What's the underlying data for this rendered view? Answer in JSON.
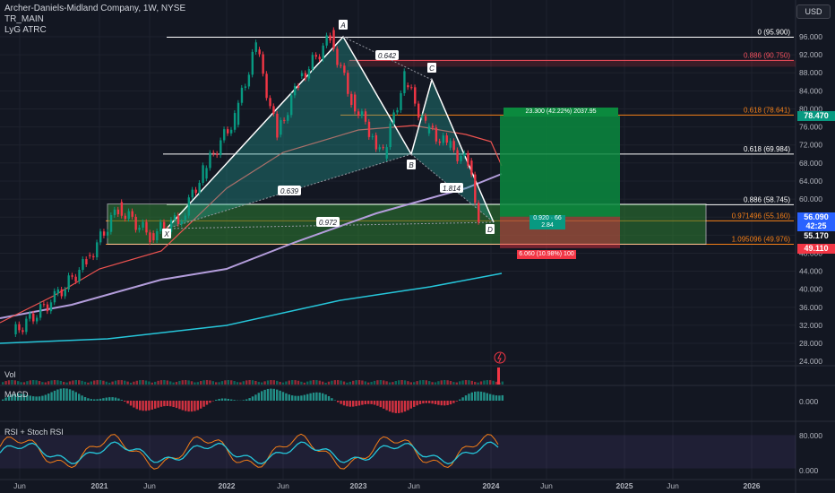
{
  "legend": {
    "title": "Archer-Daniels-Midland Company, 1W, NYSE",
    "ind1": "TR_MAIN",
    "ind2": "LyG ATRC"
  },
  "currency": "USD",
  "panes": {
    "vol": "Vol",
    "macd": "MACD",
    "rsi": "RSI + Stoch RSI"
  },
  "pattern_points": [
    {
      "label": "X",
      "date": "2021-06",
      "price": 52.5
    },
    {
      "label": "A",
      "date": "2022-11",
      "price": 95.9
    },
    {
      "label": "B",
      "date": "2023-04",
      "price": 69.9
    },
    {
      "label": "C",
      "date": "2023-06",
      "price": 86.8
    },
    {
      "label": "D",
      "date": "2023-12",
      "price": 56.1
    }
  ],
  "ratios": {
    "xb": "0.639",
    "ac": "0.642",
    "bd": "1.814",
    "xd": "0.972"
  },
  "fib_levels": [
    {
      "label": "0 (95.900)",
      "price": 95.9,
      "color": "#ffffff"
    },
    {
      "label": "0.886 (90.750)",
      "price": 90.75,
      "color": "#f7525f"
    },
    {
      "label": "0.618 (78.641)",
      "price": 78.641,
      "color": "#f57f17"
    },
    {
      "label": "0.618 (69.984)",
      "price": 69.984,
      "color": "#ffffff"
    },
    {
      "label": "0.886 (58.745)",
      "price": 58.745,
      "color": "#ffffff"
    },
    {
      "label": "0.971496 (55.160)",
      "price": 55.16,
      "color": "#f57f17"
    },
    {
      "label": "1.095096 (49.976)",
      "price": 49.976,
      "color": "#f57f17"
    }
  ],
  "position": {
    "target_label": "23.300 (42.22%) 2037.95",
    "mid_label_1": "0.920 · 66",
    "mid_label_2": "2.84",
    "stop_label": "6.060 (10.98%) 100"
  },
  "price_axis": {
    "ticks": [
      "96.000",
      "92.000",
      "88.000",
      "84.000",
      "80.000",
      "76.000",
      "72.000",
      "68.000",
      "64.000",
      "60.000",
      "56.000",
      "52.000",
      "48.000",
      "44.000",
      "40.000",
      "36.000",
      "32.000",
      "28.000",
      "24.000"
    ],
    "tags": [
      {
        "value": "78.470",
        "color": "#089981"
      },
      {
        "value": "56.090",
        "color": "#2962ff"
      },
      {
        "value": "42:25",
        "color": "#2962ff"
      },
      {
        "value": "55.170",
        "color": "#131722"
      },
      {
        "value": "49.110",
        "color": "#f23645"
      }
    ]
  },
  "macd_axis": "0.000",
  "rsi_axis": [
    "80.000",
    "0.000"
  ],
  "time_axis": [
    "Jun",
    "2021",
    "Jun",
    "2022",
    "Jun",
    "2023",
    "Jun",
    "2024",
    "Jun",
    "2025",
    "Jun",
    "2026"
  ],
  "chart_data": {
    "type": "line",
    "title": "Archer-Daniels-Midland Company, 1W, NYSE",
    "ylim": [
      24,
      98
    ],
    "series": [
      {
        "name": "price",
        "x": [
          "2020-05",
          "2020-09",
          "2020-12",
          "2021-03",
          "2021-06",
          "2021-09",
          "2021-11",
          "2022-02",
          "2022-04",
          "2022-06",
          "2022-08",
          "2022-11",
          "2023-01",
          "2023-03",
          "2023-04",
          "2023-06",
          "2023-08",
          "2023-10",
          "2023-12",
          "2024-01"
        ],
        "values": [
          30,
          38,
          46,
          58,
          52,
          56,
          66,
          78,
          94,
          74,
          86,
          95.9,
          82,
          74,
          69.9,
          86.8,
          76,
          72,
          68,
          56.1
        ]
      }
    ]
  }
}
